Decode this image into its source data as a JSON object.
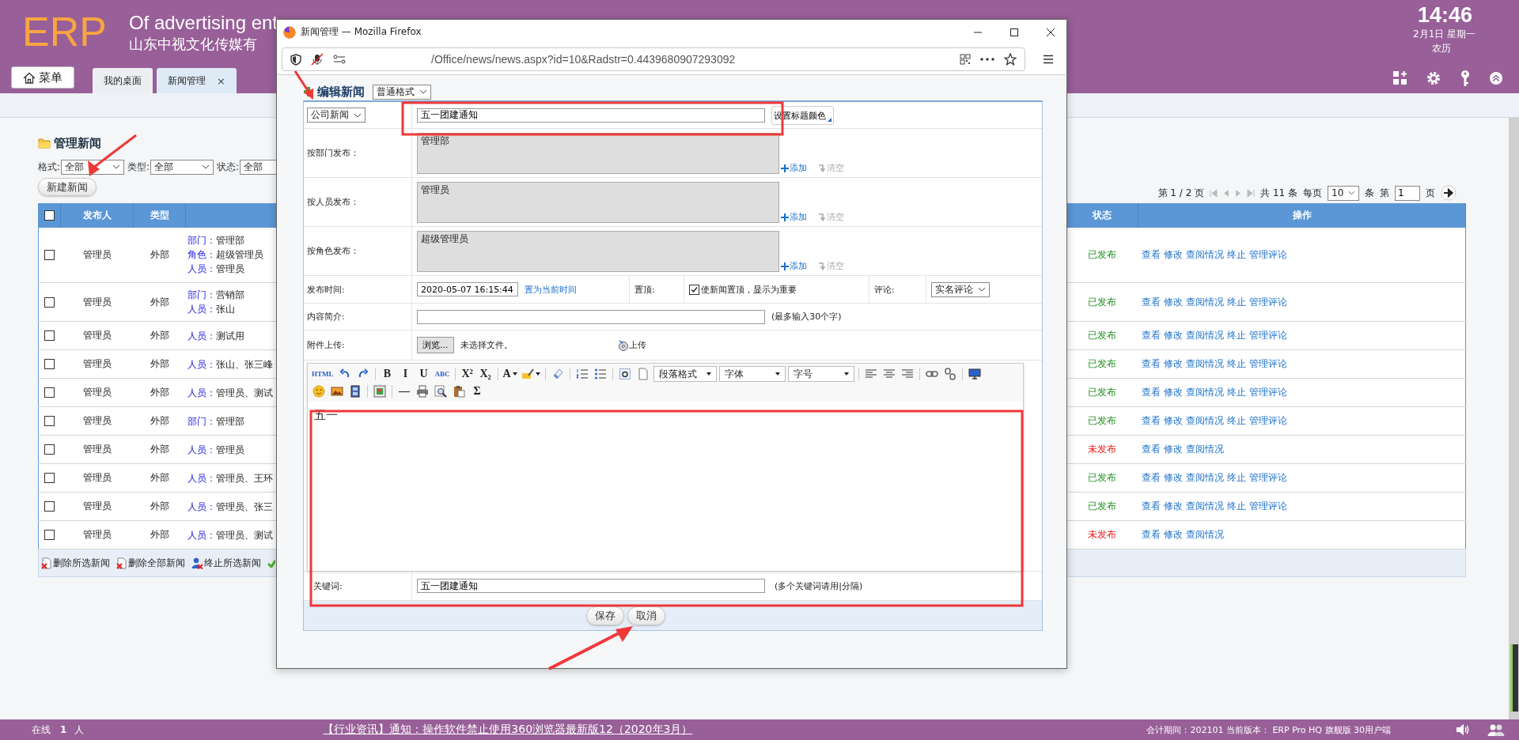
{
  "header": {
    "logo": "ERP",
    "company_en": "Of advertising ent",
    "company_cn": "山东中视文化传媒有",
    "menu_button": "菜单",
    "tabs": [
      {
        "label": "我的桌面",
        "selected": false
      },
      {
        "label": "新闻管理",
        "selected": true,
        "close": "×"
      }
    ],
    "clock": {
      "time": "14:46",
      "date": "2月1日 星期一",
      "lunar": "农历"
    }
  },
  "news": {
    "title": "管理新闻",
    "filters": [
      {
        "label": "格式:",
        "value": "全部"
      },
      {
        "label": "类型:",
        "value": "全部"
      },
      {
        "label": "状态:",
        "value": "全部"
      }
    ],
    "new_button": "新建新闻",
    "pagination": {
      "page": "第 1 / 2 页",
      "total": "共 11 条",
      "per_page_label": "每页",
      "per_page": "10",
      "unit": "条",
      "goto_label": "第",
      "goto_value": "1",
      "goto_unit": "页"
    }
  },
  "table": {
    "select_all": false,
    "columns": [
      "发布人",
      "类型",
      "状态",
      "操作"
    ],
    "rows": [
      {
        "checked": false,
        "publisher": "管理员",
        "type": "外部",
        "scope": [
          {
            "key": "部门：",
            "value": "管理部"
          },
          {
            "key": "角色：",
            "value": "超级管理员"
          },
          {
            "key": "人员：",
            "value": "管理员"
          }
        ],
        "status": "已发布",
        "published": true,
        "actions": [
          "查看",
          "修改",
          "查阅情况",
          "终止",
          "管理评论"
        ]
      },
      {
        "checked": false,
        "publisher": "管理员",
        "type": "外部",
        "scope": [
          {
            "key": "部门：",
            "value": "营销部"
          },
          {
            "key": "人员：",
            "value": "张山"
          }
        ],
        "status": "已发布",
        "published": true,
        "actions": [
          "查看",
          "修改",
          "查阅情况",
          "终止",
          "管理评论"
        ]
      },
      {
        "checked": false,
        "publisher": "管理员",
        "type": "外部",
        "scope": [
          {
            "key": "人员：",
            "value": "测试用"
          }
        ],
        "status": "已发布",
        "published": true,
        "actions": [
          "查看",
          "修改",
          "查阅情况",
          "终止",
          "管理评论"
        ]
      },
      {
        "checked": false,
        "publisher": "管理员",
        "type": "外部",
        "scope": [
          {
            "key": "人员：",
            "value": "张山、张三峰"
          }
        ],
        "status": "已发布",
        "published": true,
        "actions": [
          "查看",
          "修改",
          "查阅情况",
          "终止",
          "管理评论"
        ]
      },
      {
        "checked": false,
        "publisher": "管理员",
        "type": "外部",
        "scope": [
          {
            "key": "人员：",
            "value": "管理员、测试"
          }
        ],
        "status": "已发布",
        "published": true,
        "actions": [
          "查看",
          "修改",
          "查阅情况",
          "终止",
          "管理评论"
        ]
      },
      {
        "checked": false,
        "publisher": "管理员",
        "type": "外部",
        "scope": [
          {
            "key": "部门：",
            "value": "管理部"
          }
        ],
        "status": "已发布",
        "published": true,
        "actions": [
          "查看",
          "修改",
          "查阅情况",
          "终止",
          "管理评论"
        ]
      },
      {
        "checked": false,
        "publisher": "管理员",
        "type": "外部",
        "scope": [
          {
            "key": "人员：",
            "value": "管理员"
          }
        ],
        "status": "未发布",
        "published": false,
        "actions": [
          "查看",
          "修改",
          "查阅情况"
        ]
      },
      {
        "checked": false,
        "publisher": "管理员",
        "type": "外部",
        "scope": [
          {
            "key": "人员：",
            "value": "管理员、王环"
          }
        ],
        "status": "已发布",
        "published": true,
        "actions": [
          "查看",
          "修改",
          "查阅情况",
          "终止",
          "管理评论"
        ]
      },
      {
        "checked": false,
        "publisher": "管理员",
        "type": "外部",
        "scope": [
          {
            "key": "人员：",
            "value": "管理员、张三"
          }
        ],
        "status": "已发布",
        "published": true,
        "actions": [
          "查看",
          "修改",
          "查阅情况",
          "终止",
          "管理评论"
        ]
      },
      {
        "checked": false,
        "publisher": "管理员",
        "type": "外部",
        "scope": [
          {
            "key": "人员：",
            "value": "管理员、测试"
          }
        ],
        "status": "未发布",
        "published": false,
        "actions": [
          "查看",
          "修改",
          "查阅情况"
        ]
      }
    ],
    "footer_actions": [
      "删除所选新闻",
      "删除全部新闻",
      "终止所选新闻"
    ]
  },
  "dialog": {
    "title": "新闻管理 — Mozilla Firefox",
    "url": "/Office/news/news.aspx?id=10&Radstr=0.4439680907293092",
    "heading": "编辑新闻",
    "format_select": "普通格式",
    "category_select": "公司新闻",
    "title_input": "五一团建通知",
    "title_color_button": "设置标题颜色",
    "publish_targets": [
      {
        "label": "按部门发布：",
        "value": "管理部",
        "add": "添加",
        "clear": "清空"
      },
      {
        "label": "按人员发布：",
        "value": "管理员",
        "add": "添加",
        "clear": "清空"
      },
      {
        "label": "按角色发布：",
        "value": "超级管理员",
        "add": "添加",
        "clear": "清空"
      }
    ],
    "publish_time": {
      "label": "发布时间:",
      "value": "2020-05-07 16:15:44",
      "link": "置为当前时间"
    },
    "pin": {
      "label": "置顶:",
      "checked": true,
      "text": "使新闻置顶，显示为重要"
    },
    "comment": {
      "label": "评论:",
      "value": "实名评论"
    },
    "summary": {
      "label": "内容简介:",
      "hint": "(最多输入30个字)"
    },
    "attachment": {
      "label": "附件上传:",
      "browse": "浏览...",
      "file_status": "未选择文件。",
      "upload": "上传"
    },
    "editor": {
      "toolbar": [
        [
          {
            "kind": "glyph",
            "text": "HTML"
          },
          {
            "kind": "icon"
          },
          {
            "kind": "icon"
          },
          {
            "kind": "sep"
          },
          {
            "kind": "glyph",
            "text": "B"
          },
          {
            "kind": "glyph",
            "text": "I"
          },
          {
            "kind": "glyph",
            "text": "U"
          },
          {
            "kind": "glyph",
            "text": "ABC"
          },
          {
            "kind": "sep"
          },
          {
            "kind": "glyph",
            "text": "X²"
          },
          {
            "kind": "glyph",
            "text": "X₂"
          },
          {
            "kind": "sep"
          },
          {
            "kind": "glyph",
            "text": "A",
            "dropdown": true
          },
          {
            "kind": "icon",
            "dropdown": true
          },
          {
            "kind": "sep"
          },
          {
            "kind": "icon"
          },
          {
            "kind": "sep"
          },
          {
            "kind": "icon"
          },
          {
            "kind": "icon"
          },
          {
            "kind": "sep"
          },
          {
            "kind": "icon"
          },
          {
            "kind": "icon"
          },
          {
            "kind": "select",
            "text": "段落格式"
          },
          {
            "kind": "select",
            "text": "字体"
          },
          {
            "kind": "select",
            "text": "字号"
          },
          {
            "kind": "sep"
          },
          {
            "kind": "icon"
          },
          {
            "kind": "icon"
          },
          {
            "kind": "icon"
          },
          {
            "kind": "sep"
          },
          {
            "kind": "icon"
          },
          {
            "kind": "icon"
          },
          {
            "kind": "sep"
          },
          {
            "kind": "icon"
          }
        ],
        [
          {
            "kind": "icon"
          },
          {
            "kind": "icon"
          },
          {
            "kind": "icon"
          },
          {
            "kind": "sep"
          },
          {
            "kind": "icon"
          },
          {
            "kind": "sep"
          },
          {
            "kind": "glyph",
            "text": "—"
          },
          {
            "kind": "icon"
          },
          {
            "kind": "icon"
          },
          {
            "kind": "icon"
          },
          {
            "kind": "glyph",
            "text": "Σ"
          }
        ]
      ],
      "content": "五一"
    },
    "keywords": {
      "label": "关键词:",
      "value": "五一团建通知",
      "hint": "(多个关键词请用|分隔)"
    },
    "buttons": [
      "保存",
      "取消"
    ]
  },
  "status_bar": {
    "online_label": "在线",
    "online_count": "1",
    "online_unit": "人",
    "news_link": "【行业资讯】通知：操作软件禁止使用360浏览器最新版12（2020年3月）",
    "info": "会计期间：202101 当前版本： ERP Pro HQ 旗舰版 30用户端"
  }
}
